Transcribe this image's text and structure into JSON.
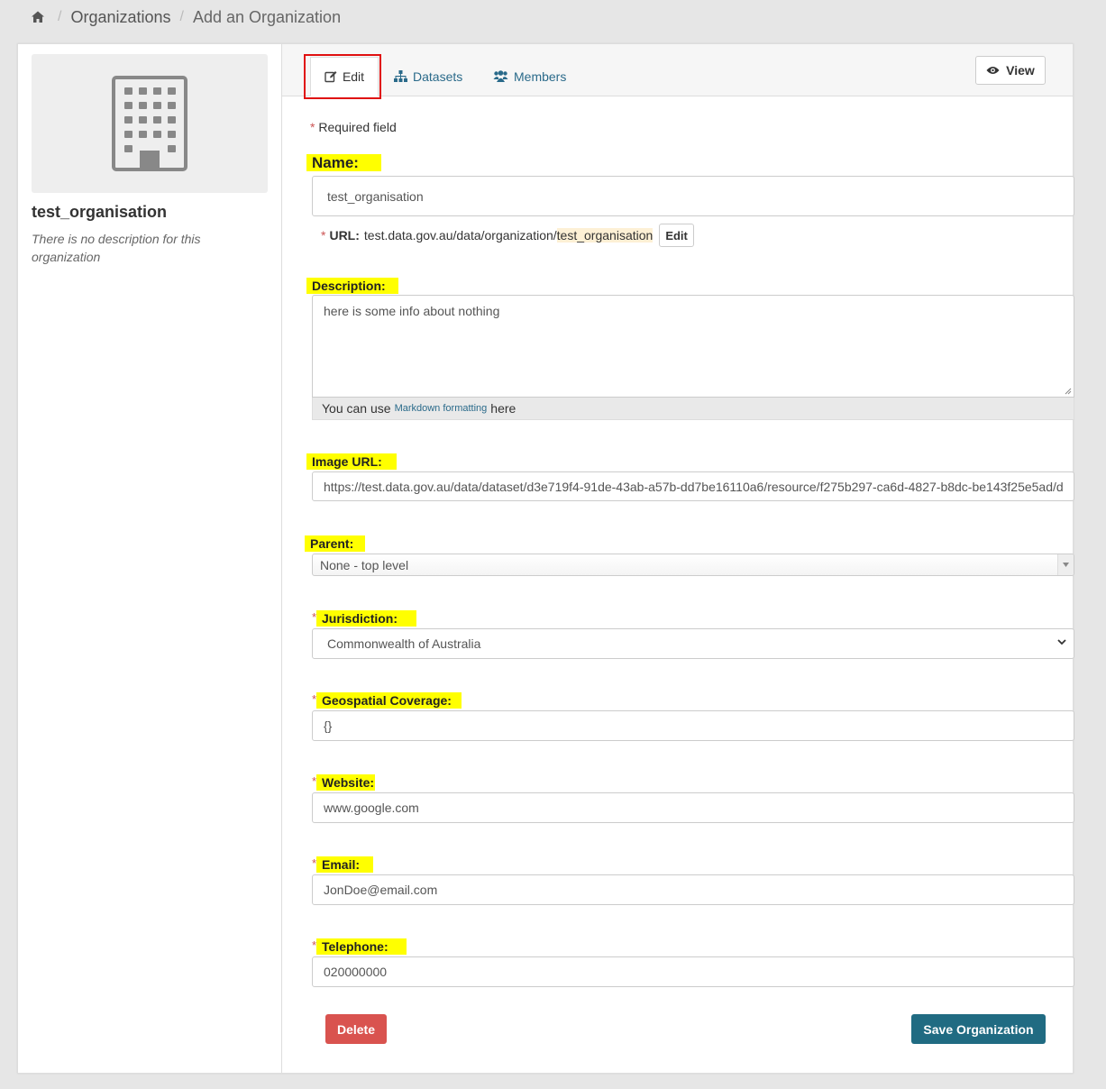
{
  "breadcrumb": {
    "home_icon": "home-icon",
    "items": [
      "Organizations",
      "Add an Organization"
    ]
  },
  "sidebar": {
    "image_icon": "building-icon",
    "title": "test_organisation",
    "description": "There is no description for this organization"
  },
  "tabs": [
    {
      "label": "Edit",
      "icon": "edit-icon",
      "active": true
    },
    {
      "label": "Datasets",
      "icon": "sitemap-icon"
    },
    {
      "label": "Members",
      "icon": "users-icon"
    }
  ],
  "view_button": {
    "label": "View",
    "icon": "eye-icon"
  },
  "form": {
    "required_note": "Required field",
    "required_marker": "*",
    "name": {
      "label": "Name:",
      "value": "test_organisation"
    },
    "url": {
      "label": "URL:",
      "prefix": "test.data.gov.au/data/organization/",
      "slug": "test_organisation",
      "edit_label": "Edit"
    },
    "description": {
      "label": "Description:",
      "value": "here is some info about nothing",
      "help_before": "You can use",
      "help_link": "Markdown formatting",
      "help_after": "here"
    },
    "image_url": {
      "label": "Image URL:",
      "value": "https://test.data.gov.au/data/dataset/d3e719f4-91de-43ab-a57b-dd7be16110a6/resource/f275b297-ca6d-4827-b8dc-be143f25e5ad/d"
    },
    "parent": {
      "label": "Parent:",
      "value": "None - top level"
    },
    "jurisdiction": {
      "label": "Jurisdiction:",
      "value": "Commonwealth of Australia"
    },
    "geospatial": {
      "label": "Geospatial Coverage:",
      "value": "{}"
    },
    "website": {
      "label": "Website:",
      "value": "www.google.com"
    },
    "email": {
      "label": "Email:",
      "value": "JonDoe@email.com"
    },
    "telephone": {
      "label": "Telephone:",
      "value": "020000000"
    }
  },
  "actions": {
    "delete_label": "Delete",
    "save_label": "Save Organization"
  },
  "colors": {
    "highlight": "#ffff00",
    "link": "#2a6a8a",
    "delete": "#d9534f",
    "save": "#206b82",
    "tab_outline": "#e01010"
  }
}
